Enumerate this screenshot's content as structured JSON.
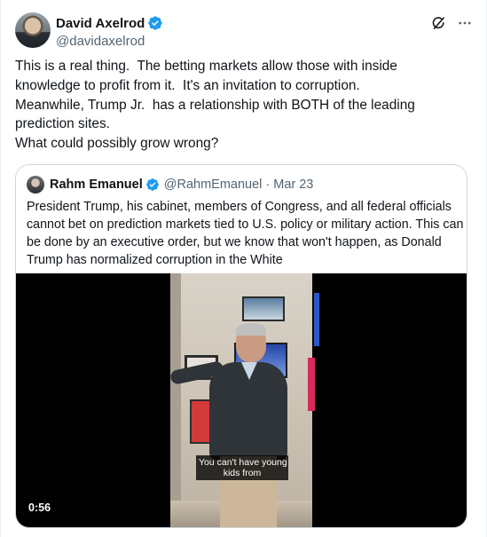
{
  "author": {
    "name": "David Axelrod",
    "handle": "@davidaxelrod",
    "verified": true
  },
  "header_actions": [
    "grok-icon",
    "more-icon"
  ],
  "post_lines": [
    "This is a real thing.  The betting markets allow those with inside",
    "knowledge to profit from it.  It's an invitation to corruption.",
    "Meanwhile, Trump Jr.  has a relationship with BOTH of the leading",
    "prediction sites.",
    "What could possibly grow wrong?"
  ],
  "quoted": {
    "name": "Rahm Emanuel",
    "handle": "@RahmEmanuel",
    "separator": "·",
    "date": "Mar 23",
    "text_lines": [
      "President Trump, his cabinet, members of Congress, and all federal officials",
      "cannot bet on prediction markets tied to U.S. policy or military action. This can",
      "be done by an executive order, but we know that won't happen, as Donald",
      "Trump has normalized corruption in the White"
    ],
    "video": {
      "caption_lines": [
        "You can't have young",
        "kids from"
      ],
      "duration": "0:56"
    }
  },
  "colors": {
    "verified_blue": "#1d9bf0",
    "text_primary": "#0f1419",
    "text_secondary": "#536471",
    "border": "#cfd9de"
  }
}
